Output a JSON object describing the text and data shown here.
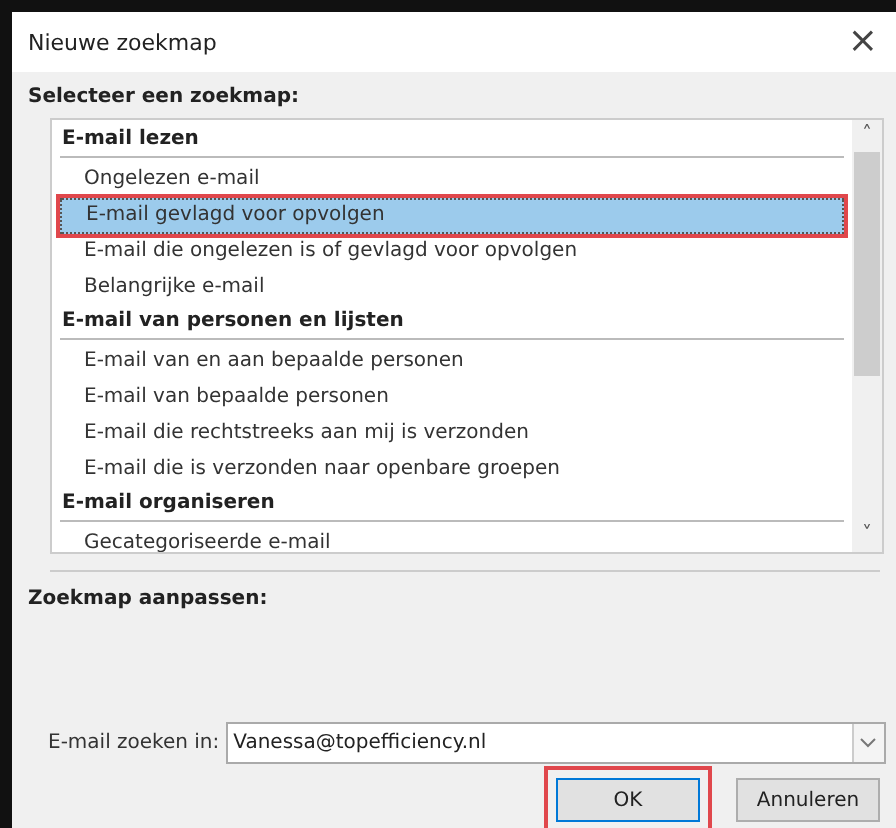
{
  "window": {
    "title": "Nieuwe zoekmap",
    "close": "×"
  },
  "select_label": "Selecteer een zoekmap:",
  "list": {
    "scroll_up": "˄",
    "scroll_down": "˅",
    "items": [
      {
        "kind": "header",
        "label": "E-mail lezen"
      },
      {
        "kind": "item",
        "label": "Ongelezen e-mail",
        "selected": false,
        "annotated": false
      },
      {
        "kind": "item",
        "label": "E-mail gevlagd voor opvolgen",
        "selected": true,
        "annotated": true
      },
      {
        "kind": "item",
        "label": "E-mail die ongelezen is of gevlagd voor opvolgen",
        "selected": false,
        "annotated": false
      },
      {
        "kind": "item",
        "label": "Belangrijke e-mail",
        "selected": false,
        "annotated": false
      },
      {
        "kind": "header",
        "label": "E-mail van personen en lijsten"
      },
      {
        "kind": "item",
        "label": "E-mail van en aan bepaalde personen",
        "selected": false,
        "annotated": false
      },
      {
        "kind": "item",
        "label": "E-mail van bepaalde personen",
        "selected": false,
        "annotated": false
      },
      {
        "kind": "item",
        "label": "E-mail die rechtstreeks aan mij is verzonden",
        "selected": false,
        "annotated": false
      },
      {
        "kind": "item",
        "label": "E-mail die is verzonden naar openbare groepen",
        "selected": false,
        "annotated": false
      },
      {
        "kind": "header",
        "label": "E-mail organiseren"
      },
      {
        "kind": "item",
        "label": "Gecategoriseerde e-mail",
        "selected": false,
        "annotated": false
      }
    ]
  },
  "customize_label": "Zoekmap aanpassen:",
  "search_in": {
    "label": "E-mail zoeken in:",
    "value": "Vanessa@topefficiency.nl"
  },
  "buttons": [
    {
      "label": "OK",
      "default": true,
      "annotated": true
    },
    {
      "label": "Annuleren",
      "default": false,
      "annotated": false
    }
  ]
}
